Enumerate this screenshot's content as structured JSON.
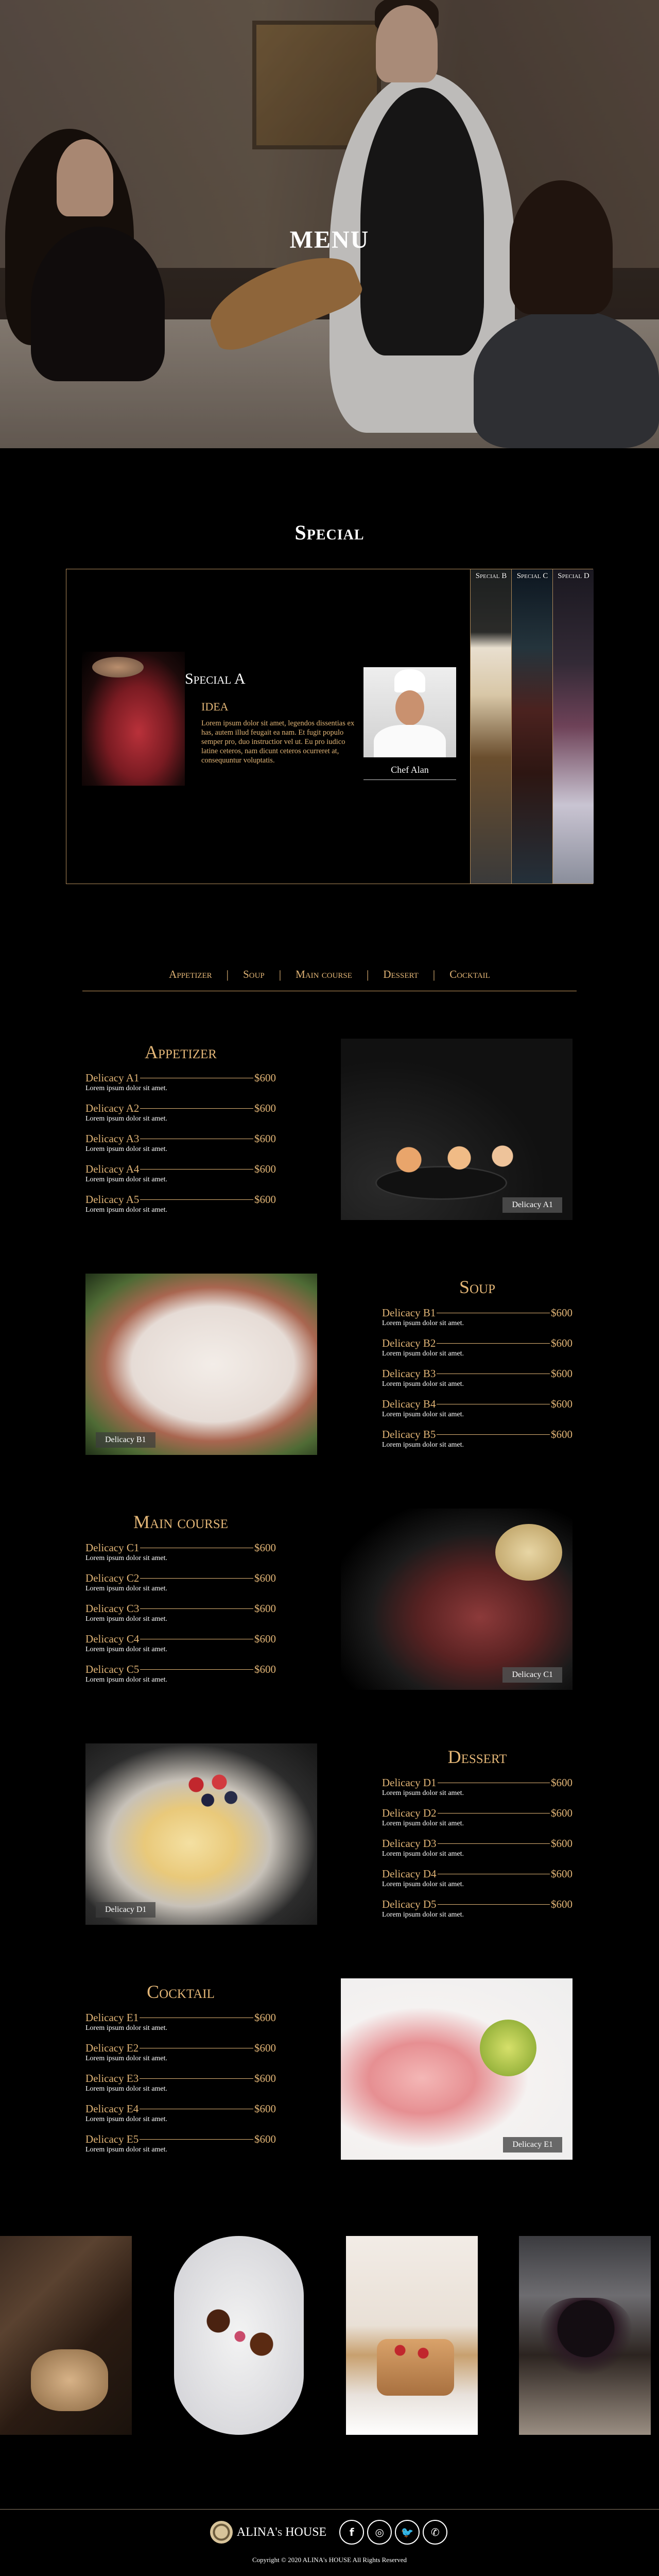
{
  "hero": {
    "title": "MENU"
  },
  "special": {
    "title": "Special",
    "main": {
      "title": "Special A",
      "subtitle": "IDEA",
      "text": "Lorem ipsum dolor sit amet, legendos dissentias ex has, autem illud feugait ea nam. Et fugit populo semper pro, duo instructior vel ut. Eu pro iudico latine ceteros, nam dicunt ceteros ocurreret at, consequuntur voluptatis.",
      "chef_name": "Chef Alan"
    },
    "tabs": [
      "Special B",
      "Special C",
      "Special D"
    ]
  },
  "nav": [
    "Appetizer",
    "Soup",
    "Main course",
    "Dessert",
    "Cocktail"
  ],
  "sections": [
    {
      "title": "Appetizer",
      "caption": "Delicacy A1",
      "items": [
        {
          "name": "Delicacy A1",
          "price": "$600",
          "desc": "Lorem ipsum dolor sit amet."
        },
        {
          "name": "Delicacy A2",
          "price": "$600",
          "desc": "Lorem ipsum dolor sit amet."
        },
        {
          "name": "Delicacy A3",
          "price": "$600",
          "desc": "Lorem ipsum dolor sit amet."
        },
        {
          "name": "Delicacy A4",
          "price": "$600",
          "desc": "Lorem ipsum dolor sit amet."
        },
        {
          "name": "Delicacy A5",
          "price": "$600",
          "desc": "Lorem ipsum dolor sit amet."
        }
      ]
    },
    {
      "title": "Soup",
      "caption": "Delicacy B1",
      "items": [
        {
          "name": "Delicacy B1",
          "price": "$600",
          "desc": "Lorem ipsum dolor sit amet."
        },
        {
          "name": "Delicacy B2",
          "price": "$600",
          "desc": "Lorem ipsum dolor sit amet."
        },
        {
          "name": "Delicacy B3",
          "price": "$600",
          "desc": "Lorem ipsum dolor sit amet."
        },
        {
          "name": "Delicacy B4",
          "price": "$600",
          "desc": "Lorem ipsum dolor sit amet."
        },
        {
          "name": "Delicacy B5",
          "price": "$600",
          "desc": "Lorem ipsum dolor sit amet."
        }
      ]
    },
    {
      "title": "Main course",
      "caption": "Delicacy C1",
      "items": [
        {
          "name": "Delicacy C1",
          "price": "$600",
          "desc": "Lorem ipsum dolor sit amet."
        },
        {
          "name": "Delicacy C2",
          "price": "$600",
          "desc": "Lorem ipsum dolor sit amet."
        },
        {
          "name": "Delicacy C3",
          "price": "$600",
          "desc": "Lorem ipsum dolor sit amet."
        },
        {
          "name": "Delicacy C4",
          "price": "$600",
          "desc": "Lorem ipsum dolor sit amet."
        },
        {
          "name": "Delicacy C5",
          "price": "$600",
          "desc": "Lorem ipsum dolor sit amet."
        }
      ]
    },
    {
      "title": "Dessert",
      "caption": "Delicacy D1",
      "items": [
        {
          "name": "Delicacy D1",
          "price": "$600",
          "desc": "Lorem ipsum dolor sit amet."
        },
        {
          "name": "Delicacy D2",
          "price": "$600",
          "desc": "Lorem ipsum dolor sit amet."
        },
        {
          "name": "Delicacy D3",
          "price": "$600",
          "desc": "Lorem ipsum dolor sit amet."
        },
        {
          "name": "Delicacy D4",
          "price": "$600",
          "desc": "Lorem ipsum dolor sit amet."
        },
        {
          "name": "Delicacy D5",
          "price": "$600",
          "desc": "Lorem ipsum dolor sit amet."
        }
      ]
    },
    {
      "title": "Cocktail",
      "caption": "Delicacy E1",
      "items": [
        {
          "name": "Delicacy E1",
          "price": "$600",
          "desc": "Lorem ipsum dolor sit amet."
        },
        {
          "name": "Delicacy E2",
          "price": "$600",
          "desc": "Lorem ipsum dolor sit amet."
        },
        {
          "name": "Delicacy E3",
          "price": "$600",
          "desc": "Lorem ipsum dolor sit amet."
        },
        {
          "name": "Delicacy E4",
          "price": "$600",
          "desc": "Lorem ipsum dolor sit amet."
        },
        {
          "name": "Delicacy E5",
          "price": "$600",
          "desc": "Lorem ipsum dolor sit amet."
        }
      ]
    }
  ],
  "gallery_icons": [
    "honey-toast-photo",
    "plated-dish-photo",
    "pancakes-photo",
    "chocolate-cake-photo"
  ],
  "footer": {
    "brand": "ALINA's HOUSE",
    "social": [
      {
        "icon": "facebook-icon",
        "glyph": "f"
      },
      {
        "icon": "instagram-icon",
        "glyph": "◎"
      },
      {
        "icon": "twitter-icon",
        "glyph": "🐦"
      },
      {
        "icon": "whatsapp-icon",
        "glyph": "✆"
      }
    ],
    "copyright": "Copyright © 2020 ALINA's HOUSE All Rights Reserved"
  },
  "colors": {
    "accent": "#e3b677",
    "border": "#b08a5a",
    "background": "#000000"
  }
}
